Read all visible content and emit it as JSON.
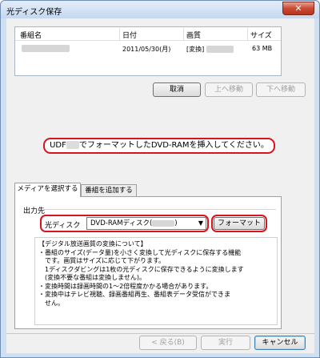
{
  "window": {
    "title": "光ディスク保存",
    "close_glyph": "✕"
  },
  "list": {
    "columns": [
      "番組名",
      "日付",
      "画質",
      "サイズ"
    ],
    "rows": [
      {
        "date": "2011/05/30(月)",
        "quality": "[変換]",
        "size": "63 MB"
      }
    ]
  },
  "list_buttons": {
    "cancel": "取消",
    "move_up": "上へ移動",
    "move_down": "下へ移動"
  },
  "instruction": {
    "prefix": "UDF",
    "suffix": "でフォーマットしたDVD-RAMを挿入してください。"
  },
  "tabs": [
    {
      "label": "メディアを選択する"
    },
    {
      "label": "番組を追加する"
    }
  ],
  "output": {
    "group_label": "出力先",
    "drive_label": "光ディスク",
    "drive_value": "DVD-RAMディスク(",
    "drive_value_end": ")",
    "format_button": "フォーマット"
  },
  "notice": {
    "lines": [
      "【デジタル放送画質の変換について】",
      "・番組のサイズ(データ量)を小さく変換して光ディスクに保存する機能",
      "　です。画質はサイズに応じて下がります。",
      "　1ディスクダビングは1枚の光ディスクに保存できるように変換します",
      "　(変換不要な番組は変換しません)。",
      "・変換時間は録画時間の1～2倍程度かかる場合があります。",
      "・変換中はテレビ視聴、録画番組再生、番組表データ受信ができま",
      "　せん。"
    ]
  },
  "footer": {
    "back": "< 戻る(B)",
    "execute": "実行",
    "cancel": "キャンセル"
  }
}
